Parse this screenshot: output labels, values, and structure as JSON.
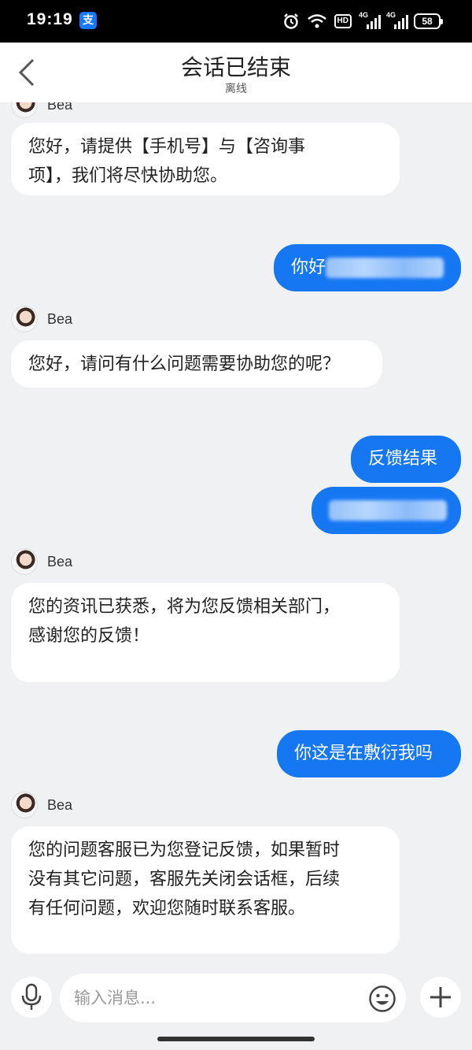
{
  "status_bar": {
    "time": "19:19",
    "app_icon_glyph": "支",
    "hd": "HD",
    "sig1": "4G",
    "sig2": "4G",
    "battery": "58"
  },
  "header": {
    "title": "会话已结束",
    "subtitle": "离线"
  },
  "messages": [
    {
      "from": "agent",
      "name": "Bea",
      "lines": [
        "您好，请提供【手机号】与【咨询事",
        "项】，我们将尽快协助您。"
      ]
    },
    {
      "from": "user",
      "text": "你好"
    },
    {
      "from": "agent",
      "name": "Bea",
      "lines": [
        "您好，请问有什么问题需要协助您的呢？"
      ]
    },
    {
      "from": "user",
      "text": "反馈结果"
    },
    {
      "from": "user",
      "text": ""
    },
    {
      "from": "agent",
      "name": "Bea",
      "lines": [
        "您的资讯已获悉，将为您反馈相关部门，",
        "感谢您的反馈！"
      ]
    },
    {
      "from": "user",
      "text": "你这是在敷衍我吗"
    },
    {
      "from": "agent",
      "name": "Bea",
      "lines": [
        "您的问题客服已为您登记反馈，如果暂时",
        "没有其它问题，客服先关闭会话框，后续",
        "有任何问题，欢迎您随时联系客服。"
      ]
    }
  ],
  "input": {
    "placeholder": "输入消息..."
  },
  "colors": {
    "user_bubble": "#1677f3",
    "background": "#eff1f3"
  }
}
